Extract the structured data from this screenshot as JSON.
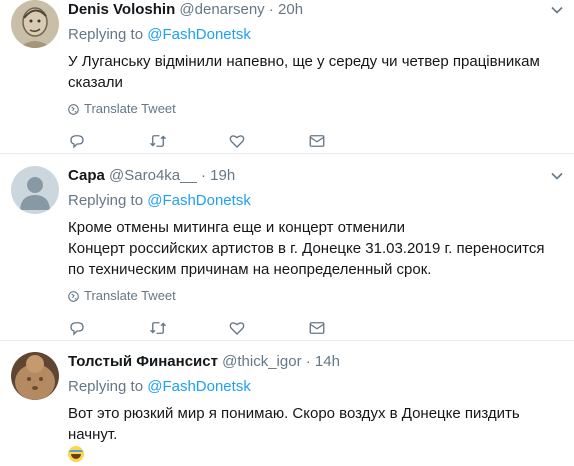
{
  "tweets": [
    {
      "name": "Denis Voloshin",
      "handle": "@denarseny",
      "dot": "·",
      "time": "20h",
      "replying_prefix": "Replying to",
      "replying_to": "@FashDonetsk",
      "text": "У Луганську відмінили напевно, ще у середу чи четвер працівникам сказали",
      "translate": "Translate Tweet",
      "avatar_color": "#b7a98e"
    },
    {
      "name": "Сара",
      "handle": "@Saro4ka__",
      "dot": "·",
      "time": "19h",
      "replying_prefix": "Replying to",
      "replying_to": "@FashDonetsk",
      "text": "Кроме отмены митинга еще и концерт отменили\nКонцерт российских артистов в г. Донецке 31.03.2019 г. переносится по техническим причинам на неопределенный срок.",
      "translate": "Translate Tweet",
      "avatar_color": "#ccd6dd"
    },
    {
      "name": "Толстый Финансист",
      "handle": "@thick_igor",
      "dot": "·",
      "time": "14h",
      "replying_prefix": "Replying to",
      "replying_to": "@FashDonetsk",
      "text": "Вот это рюзкий мир я понимаю. Скоро воздух в Донецке пиздить начнут.",
      "avatar_color": "#8a6a4a"
    }
  ],
  "colors": {
    "link": "#1da1f2",
    "secondary": "#657786",
    "separator": "#e6ecf0"
  },
  "icons": [
    "reply-icon",
    "retweet-icon",
    "like-icon",
    "message-icon",
    "globe-icon",
    "chevron-down-icon",
    "rolling-laughing-emoji"
  ]
}
